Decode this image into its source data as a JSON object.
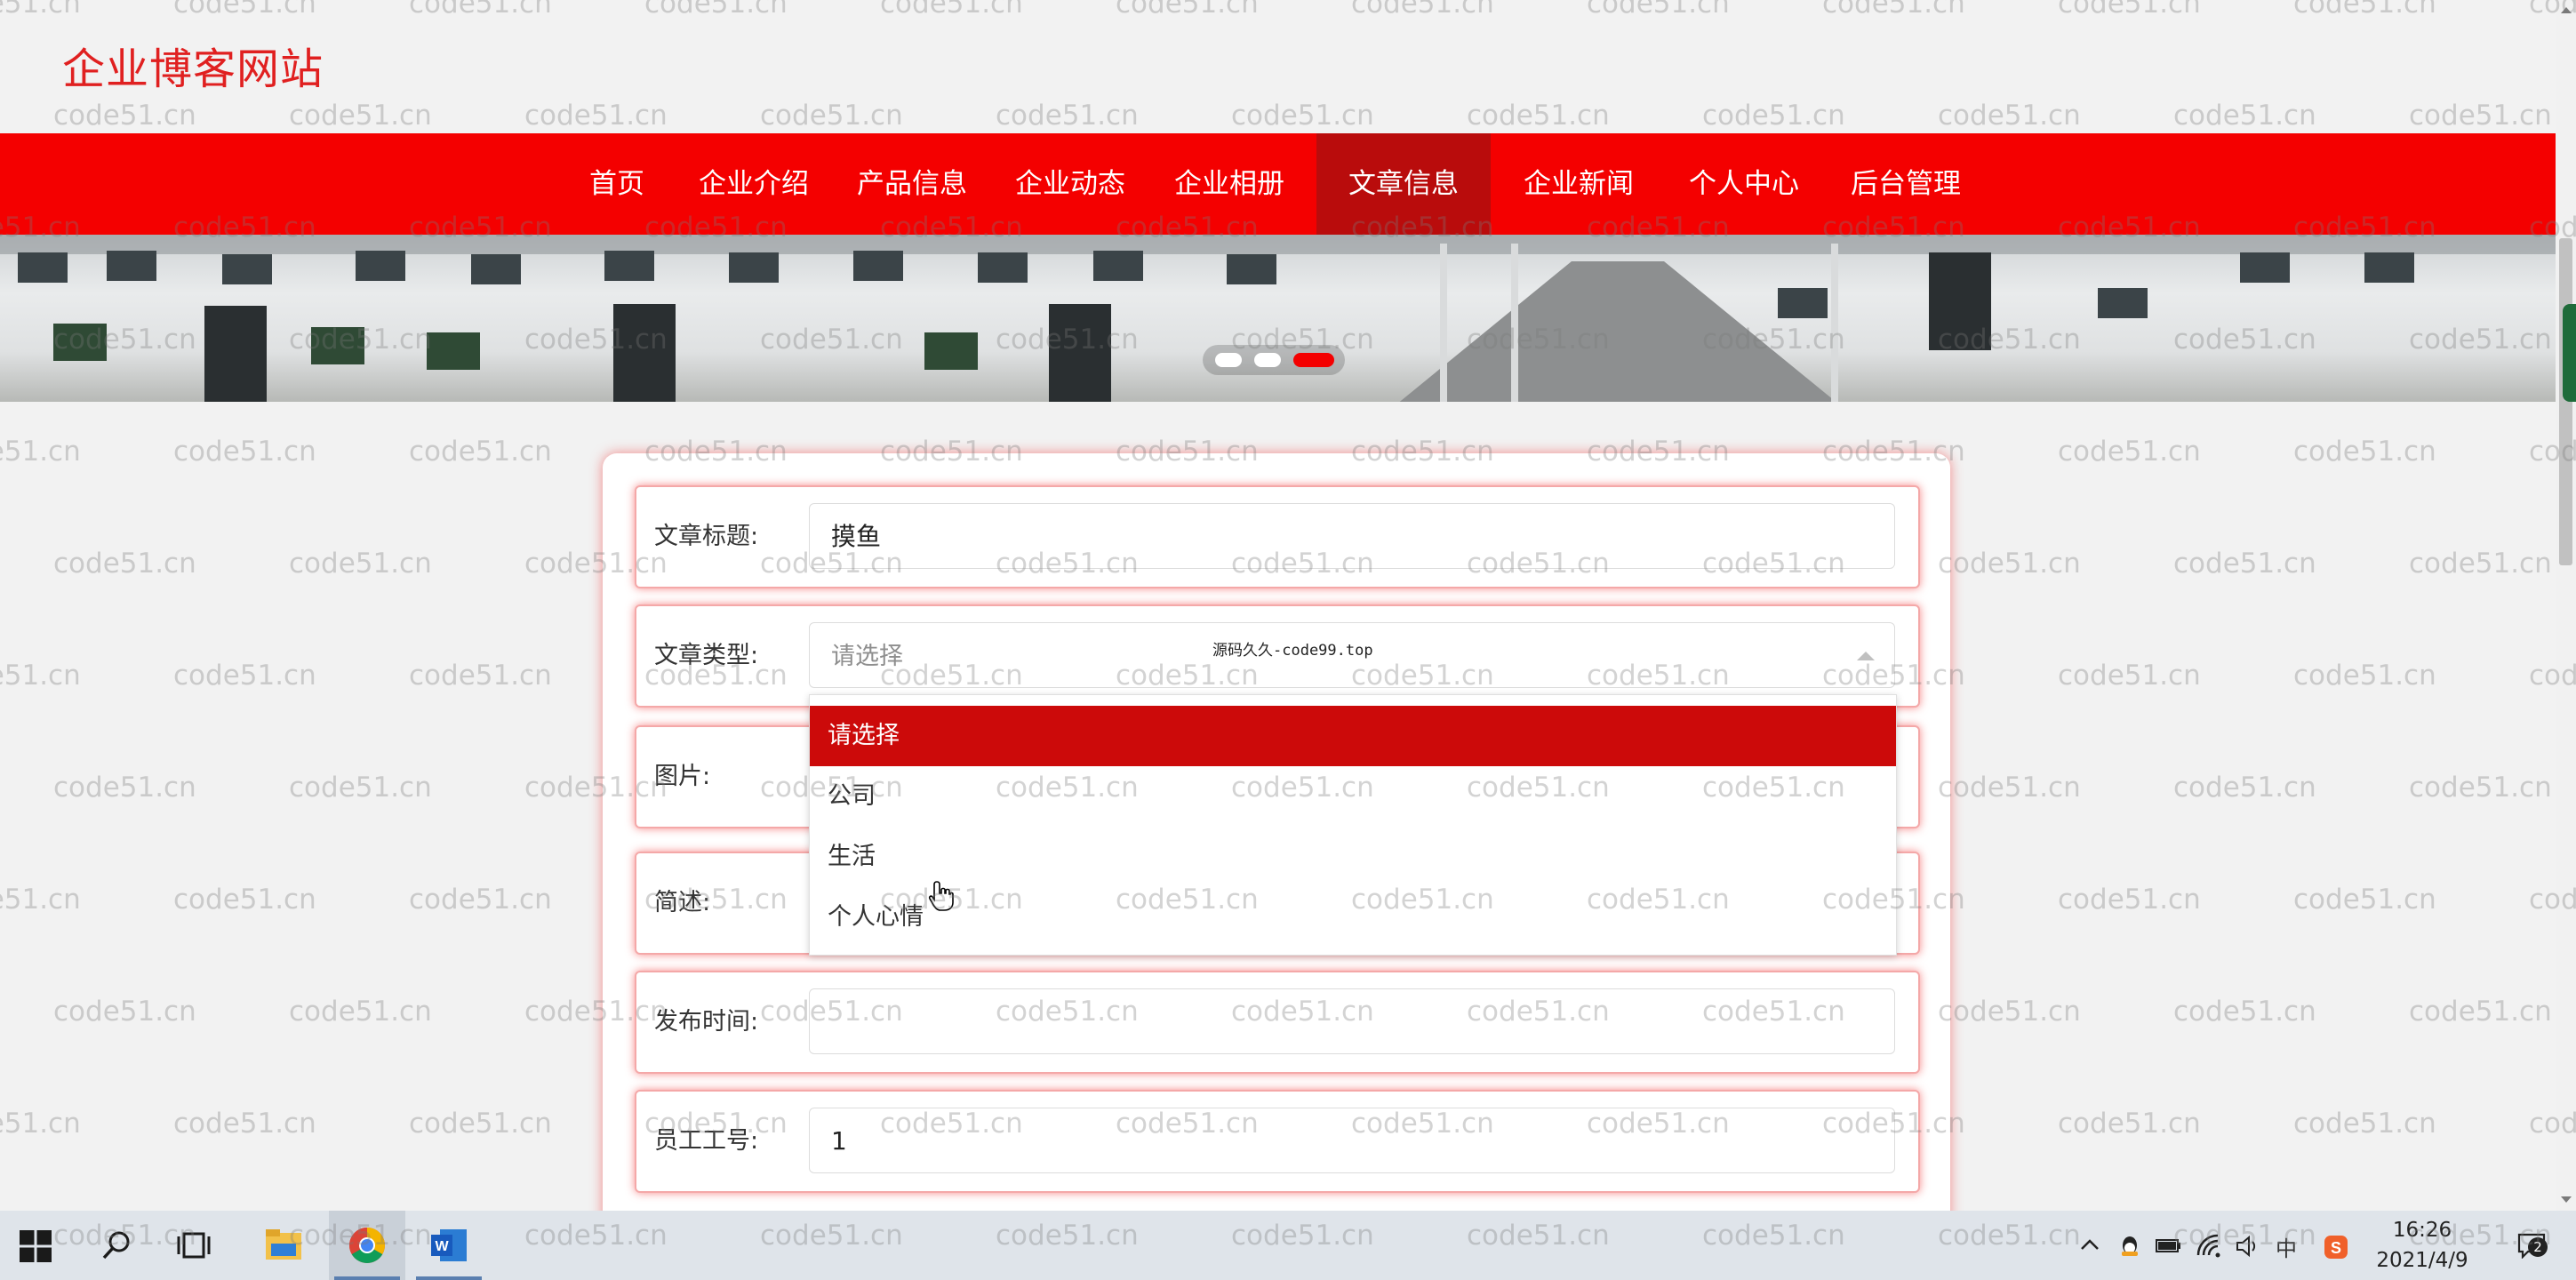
{
  "site": {
    "title": "企业博客网站"
  },
  "nav": {
    "items": [
      {
        "label": "首页"
      },
      {
        "label": "企业介绍"
      },
      {
        "label": "产品信息"
      },
      {
        "label": "企业动态"
      },
      {
        "label": "企业相册"
      },
      {
        "label": "文章信息",
        "active": true
      },
      {
        "label": "企业新闻"
      },
      {
        "label": "个人中心"
      },
      {
        "label": "后台管理"
      }
    ]
  },
  "banner": {
    "slide_count": 3,
    "active_slide": 3
  },
  "form": {
    "title_label": "文章标题:",
    "title_value": "摸鱼",
    "type_label": "文章类型:",
    "type_placeholder": "请选择",
    "image_label": "图片:",
    "summary_label": "简述:",
    "publish_label": "发布时间:",
    "publish_value": "",
    "employee_label": "员工工号:",
    "employee_value": "1"
  },
  "type_dropdown": {
    "options": [
      "请选择",
      "公司",
      "生活",
      "个人心情"
    ],
    "highlighted_index": 0
  },
  "overlay_watermark": "源码久久-code99.top",
  "background_watermark": "code51.cn",
  "taskbar": {
    "time": "16:26",
    "date": "2021/4/9",
    "ime": "中",
    "notification_count": "2"
  },
  "colors": {
    "brand_red": "#f40000",
    "nav_active": "#b90c0c",
    "dropdown_selected": "#cc0a0a",
    "title_red": "#e02020"
  },
  "icons": [
    "windows-start-icon",
    "search-icon",
    "task-view-icon",
    "file-explorer-icon",
    "chrome-icon",
    "word-icon",
    "chevron-up-icon",
    "qq-icon",
    "battery-icon",
    "wifi-icon",
    "volume-icon",
    "sogou-icon",
    "notification-icon",
    "hand-cursor-icon"
  ]
}
